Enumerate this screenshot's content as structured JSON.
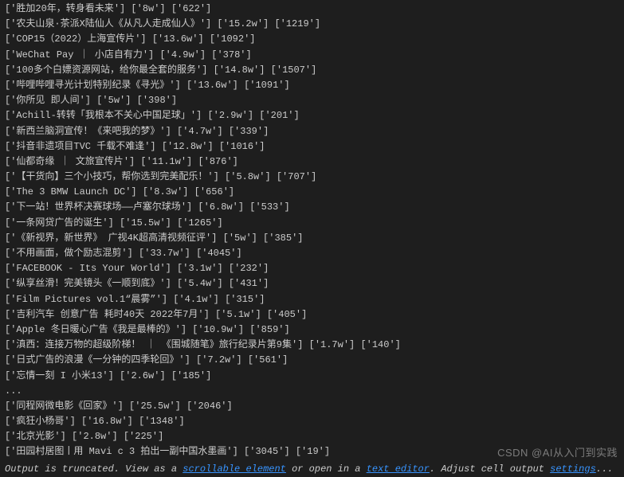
{
  "chart_data": {
    "type": "table",
    "columns": [
      "title",
      "views",
      "count"
    ],
    "rows": [
      {
        "title": "胜加20年，转身看未来",
        "views": "8w",
        "count": "622"
      },
      {
        "title": "农夫山泉·茶派X陆仙人《从凡人走成仙人》",
        "views": "15.2w",
        "count": "1219"
      },
      {
        "title": "COP15（2022）上海宣传片",
        "views": "13.6w",
        "count": "1092"
      },
      {
        "title": "WeChat Pay ｜ 小店自有力",
        "views": "4.9w",
        "count": "378"
      },
      {
        "title": "100多个白嫖资源网站，给你最全套的服务",
        "views": "14.8w",
        "count": "1507"
      },
      {
        "title": "哔哩哔哩寻光计划特别纪录《寻光》",
        "views": "13.6w",
        "count": "1091"
      },
      {
        "title": "你所见 即人间",
        "views": "5w",
        "count": "398"
      },
      {
        "title": "Achill-转转「我根本不关心中国足球」",
        "views": "2.9w",
        "count": "201"
      },
      {
        "title": "新西兰脑洞宣传！《来吧我的梦》",
        "views": "4.7w",
        "count": "339"
      },
      {
        "title": "抖音非遗项目TVC 千载不难逢",
        "views": "12.8w",
        "count": "1016"
      },
      {
        "title": "仙都奇缘 ｜ 文旅宣传片",
        "views": "11.1w",
        "count": "876"
      },
      {
        "title": "【干货向】三个小技巧，帮你选到完美配乐！",
        "views": "5.8w",
        "count": "707"
      },
      {
        "title": "The 3 BMW Launch DC",
        "views": "8.3w",
        "count": "656"
      },
      {
        "title": "下一站！世界杯决赛球场——卢塞尔球场",
        "views": "6.8w",
        "count": "533"
      },
      {
        "title": "一条网贷广告的诞生",
        "views": "15.5w",
        "count": "1265"
      },
      {
        "title": "《新视界，新世界》 广视4K超高清视频征评",
        "views": "5w",
        "count": "385"
      },
      {
        "title": "不用画面，做个励志混剪",
        "views": "33.7w",
        "count": "4045"
      },
      {
        "title": "FACEBOOK - Its Your World",
        "views": "3.1w",
        "count": "232"
      },
      {
        "title": "纵享丝滑！完美镜头《一顺到底》",
        "views": "5.4w",
        "count": "431"
      },
      {
        "title": "Film Pictures vol.1“晨雾”",
        "views": "4.1w",
        "count": "315"
      },
      {
        "title": "吉利汽车 创意广告 耗时40天 2022年7月",
        "views": "5.1w",
        "count": "405"
      },
      {
        "title": "Apple 冬日暖心广告《我是最棒的》",
        "views": "10.9w",
        "count": "859"
      },
      {
        "title": "滇西：连接万物的超级阶梯！ ｜ 《围城随笔》旅行纪录片第9集",
        "views": "1.7w",
        "count": "140"
      },
      {
        "title": "日式广告的浪漫《一分钟的四季轮回》",
        "views": "7.2w",
        "count": "561"
      },
      {
        "title": "忘情一刻 I 小米13",
        "views": "2.6w",
        "count": "185"
      },
      {
        "title": "",
        "views": "",
        "count": "",
        "ellipsis": true
      },
      {
        "title": "同程网微电影《回家》",
        "views": "25.5w",
        "count": "2046"
      },
      {
        "title": "疯狂小杨哥",
        "views": "16.8w",
        "count": "1348"
      },
      {
        "title": "北京光影",
        "views": "2.8w",
        "count": "225"
      },
      {
        "title": "田园村居图丨用 Mavi c 3 拍出一副中国水墨画",
        "views": "3045",
        "count": "19"
      }
    ]
  },
  "truncation": {
    "prefix": "Output is truncated. View as a ",
    "link1": "scrollable element",
    "mid": " or open in a ",
    "link2": "text editor",
    "suffix1": ". Adjust cell output ",
    "link3": "settings",
    "suffix2": "..."
  },
  "watermark": "CSDN @AI从入门到实践"
}
